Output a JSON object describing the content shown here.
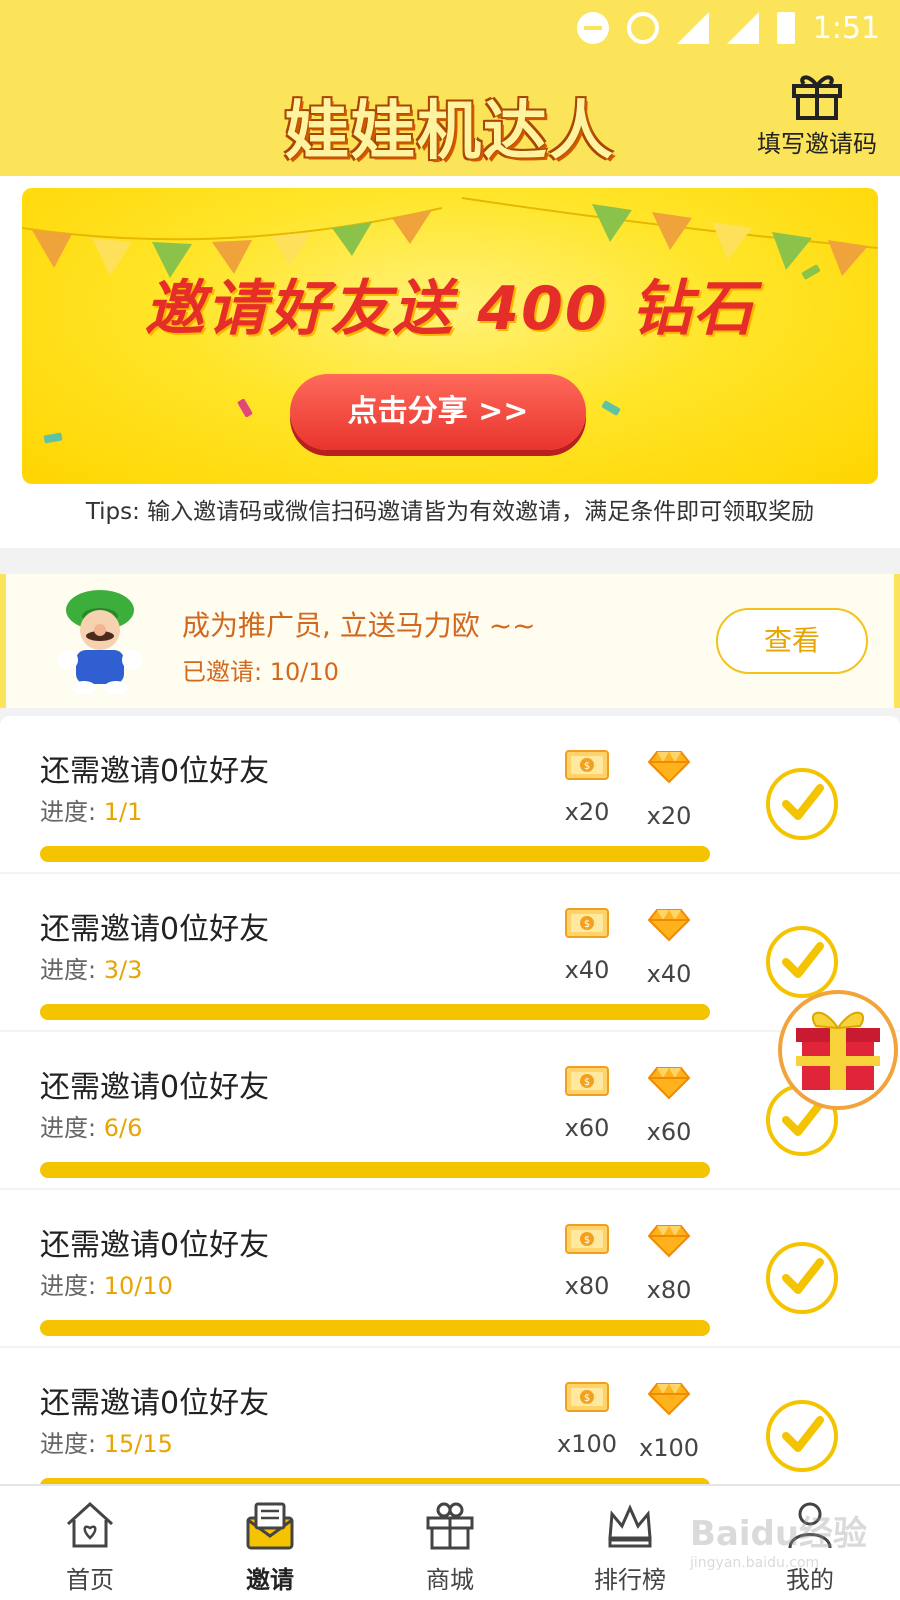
{
  "status_bar": {
    "time": "1:51",
    "network": "4G"
  },
  "header": {
    "app_title": "娃娃机达人",
    "invite_code_label": "填写邀请码"
  },
  "banner": {
    "headline": "邀请好友送 400 钻石",
    "share_button": "点击分享 >>",
    "tips": "Tips: 输入邀请码或微信扫码邀请皆为有效邀请，满足条件即可领取奖励"
  },
  "promoter": {
    "title": "成为推广员, 立送马力欧 ~~",
    "invited": "已邀请: 10/10",
    "view_button": "查看"
  },
  "tasks": [
    {
      "title": "还需邀请0位好友",
      "progress_label": "进度: ",
      "progress": "1/1",
      "coupon": "x20",
      "diamond": "x20"
    },
    {
      "title": "还需邀请0位好友",
      "progress_label": "进度: ",
      "progress": "3/3",
      "coupon": "x40",
      "diamond": "x40"
    },
    {
      "title": "还需邀请0位好友",
      "progress_label": "进度: ",
      "progress": "6/6",
      "coupon": "x60",
      "diamond": "x60"
    },
    {
      "title": "还需邀请0位好友",
      "progress_label": "进度: ",
      "progress": "10/10",
      "coupon": "x80",
      "diamond": "x80"
    },
    {
      "title": "还需邀请0位好友",
      "progress_label": "进度: ",
      "progress": "15/15",
      "coupon": "x100",
      "diamond": "x100"
    }
  ],
  "nav": [
    {
      "label": "首页",
      "icon": "home-icon"
    },
    {
      "label": "邀请",
      "icon": "invite-envelope-icon",
      "active": true
    },
    {
      "label": "商城",
      "icon": "shop-gift-icon"
    },
    {
      "label": "排行榜",
      "icon": "crown-icon"
    },
    {
      "label": "我的",
      "icon": "user-icon"
    }
  ],
  "watermark": {
    "brand": "Baidu经验",
    "url": "jingyan.baidu.com"
  },
  "colors": {
    "header_yellow": "#fbe35a",
    "accent_gold": "#f5c400",
    "share_red": "#e8342e",
    "orange_text": "#d2691e"
  }
}
